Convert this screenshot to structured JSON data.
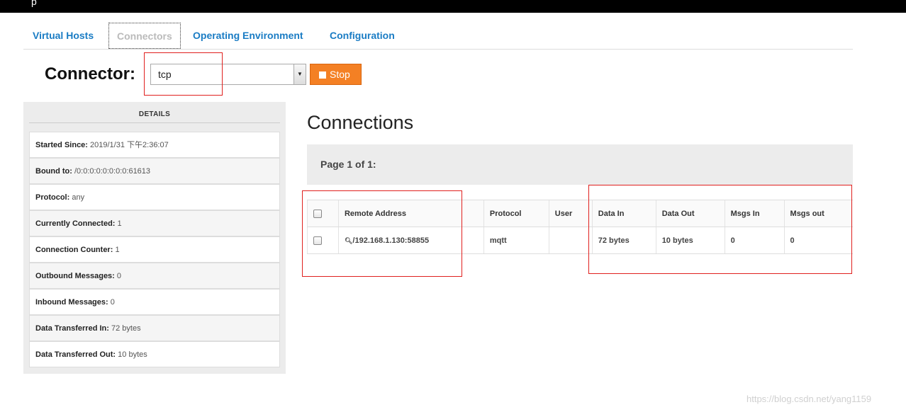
{
  "tabs": [
    {
      "label": "Virtual Hosts",
      "active": false
    },
    {
      "label": "Connectors",
      "active": true
    },
    {
      "label": "Operating Environment",
      "active": false
    },
    {
      "label": "Configuration",
      "active": false
    }
  ],
  "connector": {
    "label": "Connector:",
    "selected": "tcp",
    "stop_label": "Stop"
  },
  "details": {
    "title": "DETAILS",
    "rows": [
      {
        "label": "Started Since:",
        "value": "2019/1/31 下午2:36:07"
      },
      {
        "label": "Bound to:",
        "value": "/0:0:0:0:0:0:0:0:61613"
      },
      {
        "label": "Protocol:",
        "value": "any"
      },
      {
        "label": "Currently Connected:",
        "value": "1"
      },
      {
        "label": "Connection Counter:",
        "value": "1"
      },
      {
        "label": "Outbound Messages:",
        "value": "0"
      },
      {
        "label": "Inbound Messages:",
        "value": "0"
      },
      {
        "label": "Data Transferred In:",
        "value": "72 bytes"
      },
      {
        "label": "Data Transferred Out:",
        "value": "10 bytes"
      }
    ]
  },
  "connections": {
    "title": "Connections",
    "pager": "Page 1 of 1:",
    "headers": [
      "Remote Address",
      "Protocol",
      "User",
      "Data In",
      "Data Out",
      "Msgs In",
      "Msgs out"
    ],
    "rows": [
      {
        "remote": "/192.168.1.130:58855",
        "protocol": "mqtt",
        "user": "",
        "data_in": "72 bytes",
        "data_out": "10 bytes",
        "msgs_in": "0",
        "msgs_out": "0"
      }
    ]
  },
  "watermark": "https://blog.csdn.net/yang1159",
  "colors": {
    "accent": "#1a7cc4",
    "stop": "#f48024",
    "annotation": "#e0201e"
  }
}
